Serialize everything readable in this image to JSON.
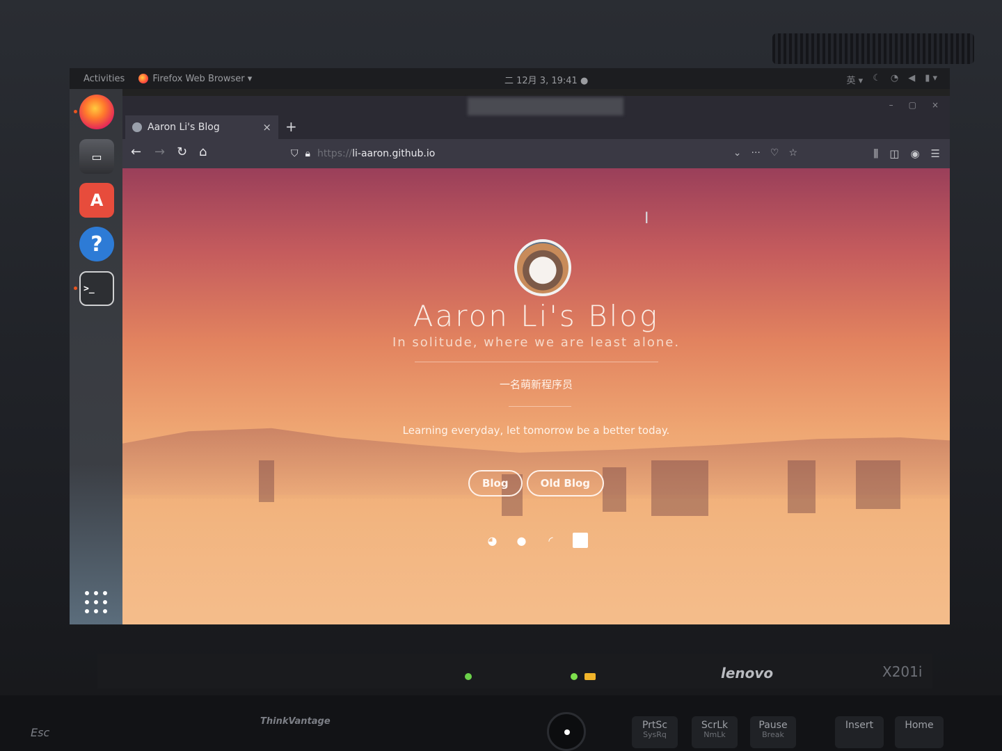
{
  "topbar": {
    "activities": "Activities",
    "app_name": "Firefox Web Browser ▾",
    "clock": "二 12月  3, 19:41 ●",
    "right_icons": [
      "input-method-icon",
      "night-light-icon",
      "wifi-icon",
      "volume-icon",
      "battery-icon"
    ]
  },
  "dock": {
    "items": [
      "firefox-icon",
      "files-icon",
      "software-store-icon",
      "help-icon",
      "terminal-icon"
    ],
    "terminal_glyph": ">_",
    "help_glyph": "?",
    "store_glyph": "A"
  },
  "browser": {
    "tab_title": "Aaron Li's Blog",
    "tab_close": "×",
    "new_tab": "+",
    "url_prefix": "https://",
    "url_host": "li-aaron.github.io",
    "window_buttons": [
      "–",
      "▢",
      "×"
    ]
  },
  "page": {
    "title": "Aaron Li's Blog",
    "subtitle": "In solitude, where we are least alone.",
    "description_cn": "一名萌新程序员",
    "description_en": "Learning everyday, let tomorrow be a better today.",
    "buttons": [
      "Blog",
      "Old Blog"
    ],
    "social_icons": [
      "weibo-icon",
      "github-icon",
      "rss-icon",
      "email-icon"
    ]
  },
  "hardware": {
    "brand": "lenovo",
    "model": "X201i",
    "thinkvantage": "ThinkVantage",
    "keys": [
      {
        "top": "PrtSc",
        "bottom": "SysRq"
      },
      {
        "top": "ScrLk",
        "bottom": "NmLk"
      },
      {
        "top": "Pause",
        "bottom": "Break"
      },
      {
        "top": "Insert",
        "bottom": ""
      },
      {
        "top": "Home",
        "bottom": ""
      }
    ],
    "esc": "Esc"
  },
  "colors": {
    "accent": "#e95420",
    "page_top": "#9a3f5a",
    "page_bottom": "#f1b585"
  }
}
